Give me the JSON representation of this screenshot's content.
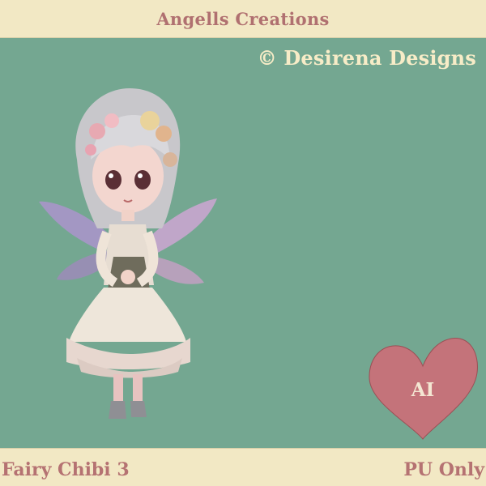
{
  "header": {
    "title": "Angells Creations"
  },
  "canvas": {
    "copyright": "© Desirena Designs",
    "background_color": "#74a791",
    "illustration": "fairy-chibi-figure",
    "badge": {
      "shape": "heart",
      "label": "AI",
      "color": "#c4737a"
    }
  },
  "footer": {
    "product_name": "Fairy Chibi 3",
    "license": "PU Only"
  },
  "colors": {
    "banner": "#f2e8c4",
    "banner_text": "#b57272",
    "copyright_text": "#f7ecc7"
  }
}
